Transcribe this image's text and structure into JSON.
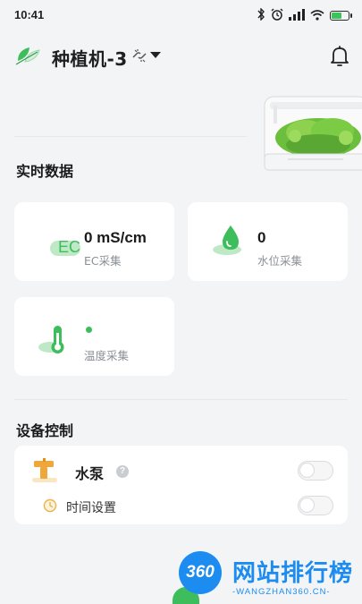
{
  "status_bar": {
    "time": "10:41",
    "icons": [
      "bluetooth-icon",
      "alarm-icon",
      "signal-icon",
      "wifi-icon",
      "battery-icon"
    ],
    "battery_level": 0.55,
    "battery_color": "#3cc35a"
  },
  "header": {
    "device_name": "种植机-3",
    "icons": [
      "leaf-logo-icon",
      "link-broken-icon",
      "chevron-down-icon",
      "bell-icon"
    ]
  },
  "realtime": {
    "section_title": "实时数据",
    "ec": {
      "badge": "EC",
      "value": "0 mS/cm",
      "label": "EC采集"
    },
    "water": {
      "value": "0",
      "label": "水位采集"
    },
    "temp": {
      "value": "",
      "label": "温度采集"
    }
  },
  "controls": {
    "section_title": "设备控制",
    "pump_label": "水泵",
    "pump_help": "?",
    "pump_on": false,
    "time_label": "时间设置",
    "time_on": false
  },
  "watermark": {
    "logo_text": "360",
    "name": "网站排行榜",
    "url": "-WANGZHAN360.CN-"
  },
  "colors": {
    "accent_green": "#3dbd5b",
    "icon_green_light": "#bfe8c6",
    "watermark_blue": "#1d8cf0",
    "background": "#f3f4f6"
  }
}
